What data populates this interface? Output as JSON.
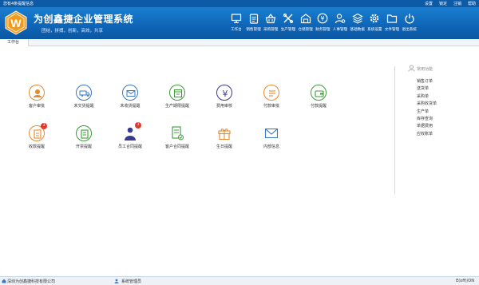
{
  "titlebar": {
    "notice": "您有4条提醒信息",
    "menu": [
      "设置",
      "锁定",
      "注销",
      "帮助"
    ]
  },
  "app": {
    "title": "为创鑫捷企业管理系统",
    "slogan": "团结，拼搏，创新，高效，共享"
  },
  "topnav": [
    {
      "label": "工作台",
      "icon": "monitor-icon"
    },
    {
      "label": "销售管理",
      "icon": "clipboard-icon"
    },
    {
      "label": "采购管理",
      "icon": "basket-icon"
    },
    {
      "label": "生产管理",
      "icon": "tools-icon"
    },
    {
      "label": "仓储管理",
      "icon": "warehouse-icon"
    },
    {
      "label": "财务管理",
      "icon": "yen-icon"
    },
    {
      "label": "人事管理",
      "icon": "person-gear-icon"
    },
    {
      "label": "基础数据",
      "icon": "layers-icon"
    },
    {
      "label": "系统设置",
      "icon": "gear-icon"
    },
    {
      "label": "文件管理",
      "icon": "folder-icon"
    },
    {
      "label": "退出系统",
      "icon": "power-icon"
    }
  ],
  "tab": {
    "label": "工作台"
  },
  "shortcuts": [
    {
      "label": "客户审批",
      "icon": "customer-approve-icon",
      "badge": ""
    },
    {
      "label": "未交货提醒",
      "icon": "truck-icon",
      "badge": ""
    },
    {
      "label": "未收货提醒",
      "icon": "mail-receive-icon",
      "badge": ""
    },
    {
      "label": "生产期限提醒",
      "icon": "calendar-icon",
      "badge": ""
    },
    {
      "label": "费用审核",
      "icon": "yen-circle-icon",
      "badge": ""
    },
    {
      "label": "付款审批",
      "icon": "payment-doc-icon",
      "badge": ""
    },
    {
      "label": "付款提醒",
      "icon": "wallet-icon",
      "badge": ""
    },
    {
      "label": "收款提醒",
      "icon": "receive-doc-icon",
      "badge": "3"
    },
    {
      "label": "开票提醒",
      "icon": "invoice-icon",
      "badge": ""
    },
    {
      "label": "员工合同提醒",
      "icon": "employee-icon",
      "badge": "3"
    },
    {
      "label": "客户合同提醒",
      "icon": "contract-icon",
      "badge": ""
    },
    {
      "label": "生日提醒",
      "icon": "gift-icon",
      "badge": ""
    },
    {
      "label": "内部信息",
      "icon": "envelope-icon",
      "badge": ""
    }
  ],
  "side": {
    "title": "常用功能",
    "items": [
      "销售订单",
      "送货单",
      "采购单",
      "采购收货单",
      "生产单",
      "库存查询",
      "单据费用",
      "应收账单"
    ]
  },
  "status": {
    "company": "深圳为创鑫捷科技有限公司",
    "user": "系统管理员",
    "right": "E(off)/ON"
  }
}
